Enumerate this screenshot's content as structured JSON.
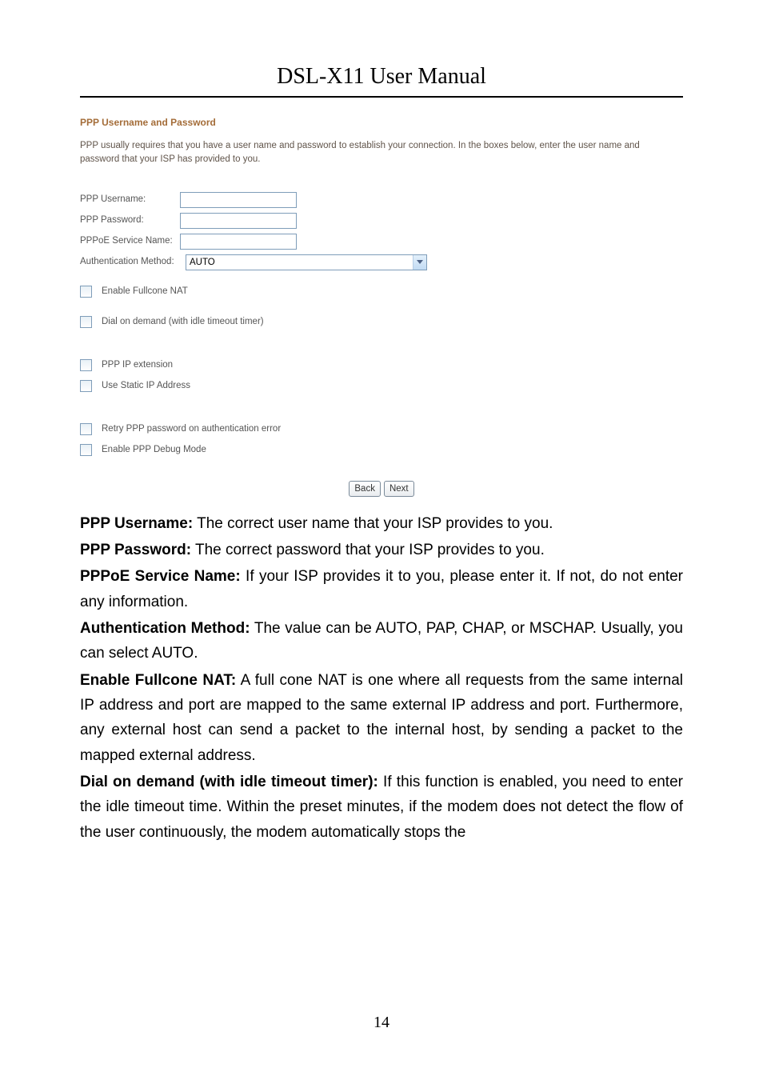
{
  "header": {
    "title": "DSL-X11 User Manual"
  },
  "screenshot": {
    "heading": "PPP Username and Password",
    "intro": "PPP usually requires that you have a user name and password to establish your connection. In the boxes below, enter the user name and password that your ISP has provided to you.",
    "fields": {
      "username_label": "PPP Username:",
      "username_value": "",
      "password_label": "PPP Password:",
      "password_value": "",
      "service_label": "PPPoE Service Name:",
      "service_value": "",
      "auth_label": "Authentication Method:",
      "auth_value": "AUTO"
    },
    "checkboxes": {
      "fullcone": "Enable Fullcone NAT",
      "dial": "Dial on demand (with idle timeout timer)",
      "ipext": "PPP IP extension",
      "staticip": "Use Static IP Address",
      "retry": "Retry PPP password on authentication error",
      "debug": "Enable PPP Debug Mode"
    },
    "buttons": {
      "back": "Back",
      "next": "Next"
    }
  },
  "explanations": {
    "p1_lead": "PPP Username:",
    "p1_body": " The correct user name that your ISP provides to you.",
    "p2_lead": "PPP Password:",
    "p2_body": " The correct password that your ISP provides to you.",
    "p3_lead": "PPPoE Service Name:",
    "p3_body": " If your ISP provides it to you, please enter it. If not, do not enter any information.",
    "p4_lead": "Authentication Method:",
    "p4_body": " The value can be AUTO, PAP, CHAP, or MSCHAP. Usually, you can select AUTO.",
    "p5_lead": "Enable Fullcone NAT:",
    "p5_body": " A full cone NAT is one where all requests from the same internal IP address and port are mapped to the same external IP address and port. Furthermore, any external host can send a packet to the internal host, by sending a packet to the mapped external address.",
    "p6_lead": "Dial on demand (with idle timeout timer):",
    "p6_body": " If this function is enabled, you need to enter the idle timeout time. Within the preset minutes, if the modem does not detect the flow of the user continuously, the modem automatically stops the"
  },
  "page_number": "14"
}
